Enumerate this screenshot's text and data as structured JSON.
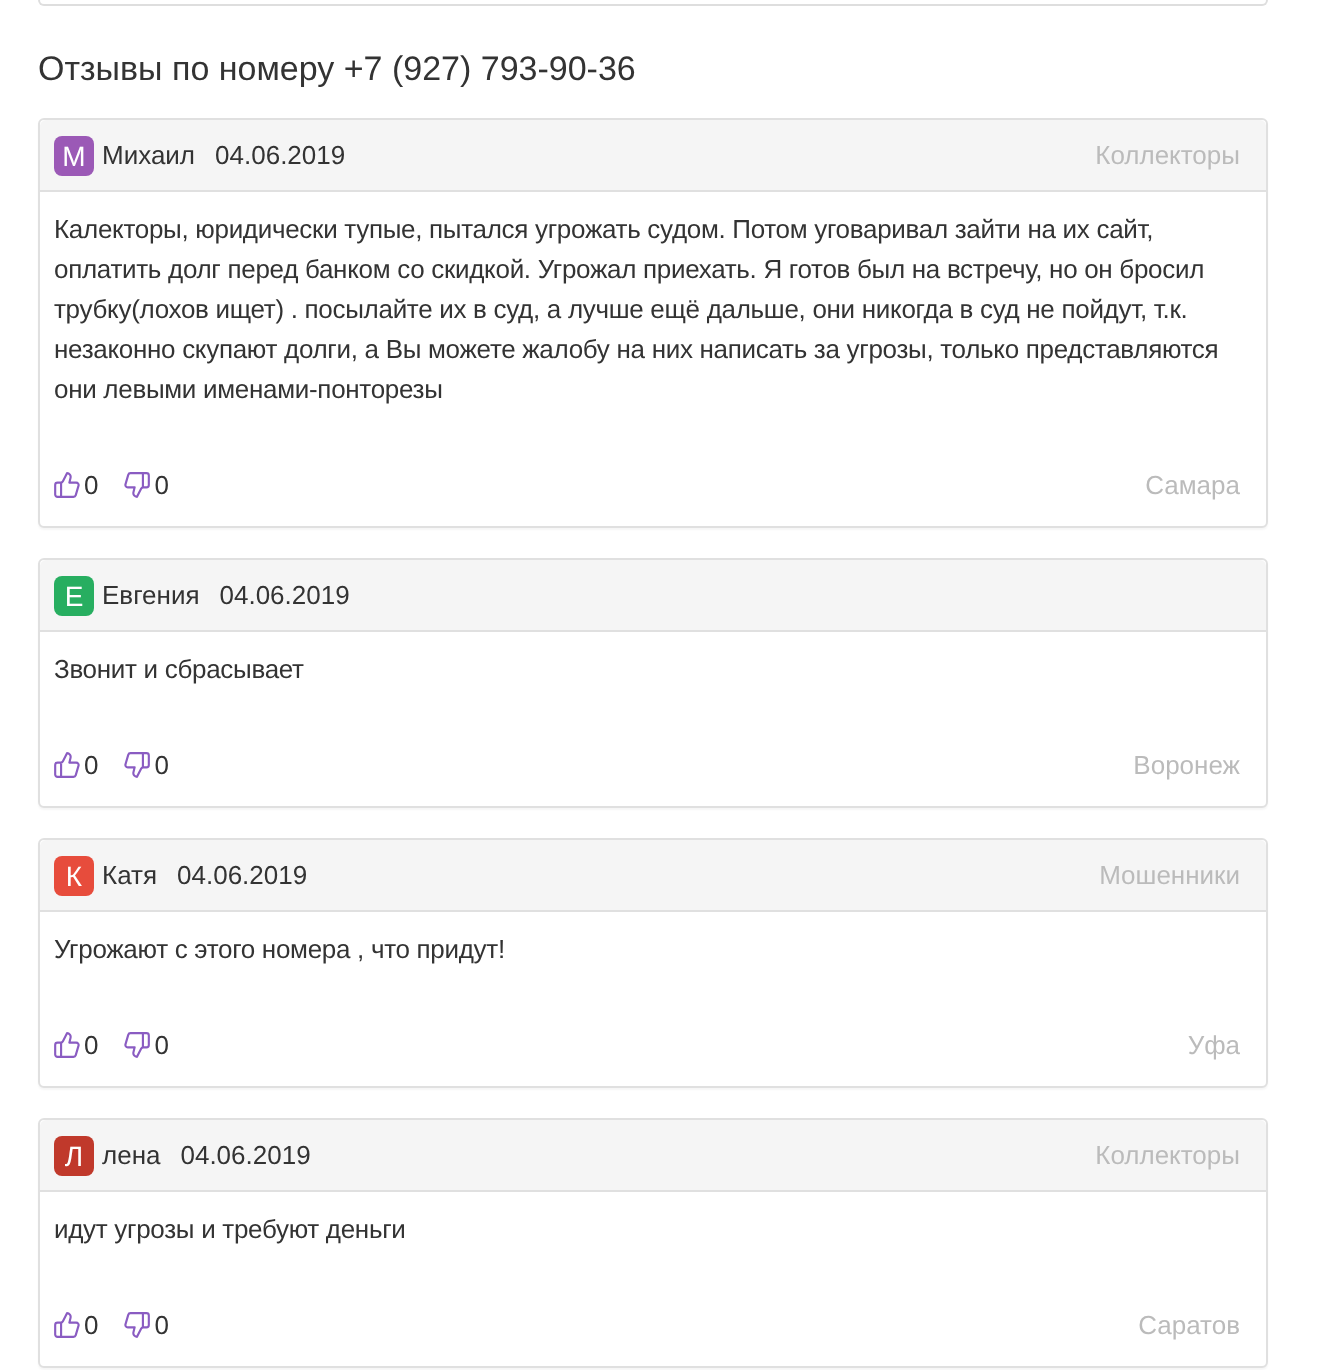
{
  "heading": "Отзывы по номеру +7 (927) 793-90-36",
  "reviews": [
    {
      "avatar": {
        "letter": "М",
        "color": "#9b59b6"
      },
      "author": "Михаил",
      "date": "04.06.2019",
      "category": "Коллекторы",
      "text": "Калекторы, юридически тупые, пытался угрожать судом. Потом уговаривал зайти на их сайт, оплатить долг перед банком со скидкой. Угрожал приехать. Я готов был на встречу, но он бросил трубку(лохов ищет) . посылайте их в суд, а лучше ещё дальше, они никогда в суд не пойдут, т.к. незаконно скупают долги, а Вы можете жалобу на них написать за угрозы, только представляются они левыми именами-понторезы",
      "likes": "0",
      "dislikes": "0",
      "city": "Самара"
    },
    {
      "avatar": {
        "letter": "Е",
        "color": "#27ae60"
      },
      "author": "Евгения",
      "date": "04.06.2019",
      "text": "Звонит и сбрасывает",
      "likes": "0",
      "dislikes": "0",
      "city": "Воронеж"
    },
    {
      "avatar": {
        "letter": "К",
        "color": "#e74c3c"
      },
      "author": "Катя",
      "date": "04.06.2019",
      "category": "Мошенники",
      "text": "Угрожают с этого номера , что придут!",
      "likes": "0",
      "dislikes": "0",
      "city": "Уфа"
    },
    {
      "avatar": {
        "letter": "Л",
        "color": "#c0392b"
      },
      "author": "лена",
      "date": "04.06.2019",
      "category": "Коллекторы",
      "text": "идут угрозы и требуют деньги",
      "likes": "0",
      "dislikes": "0",
      "city": "Саратов"
    }
  ]
}
